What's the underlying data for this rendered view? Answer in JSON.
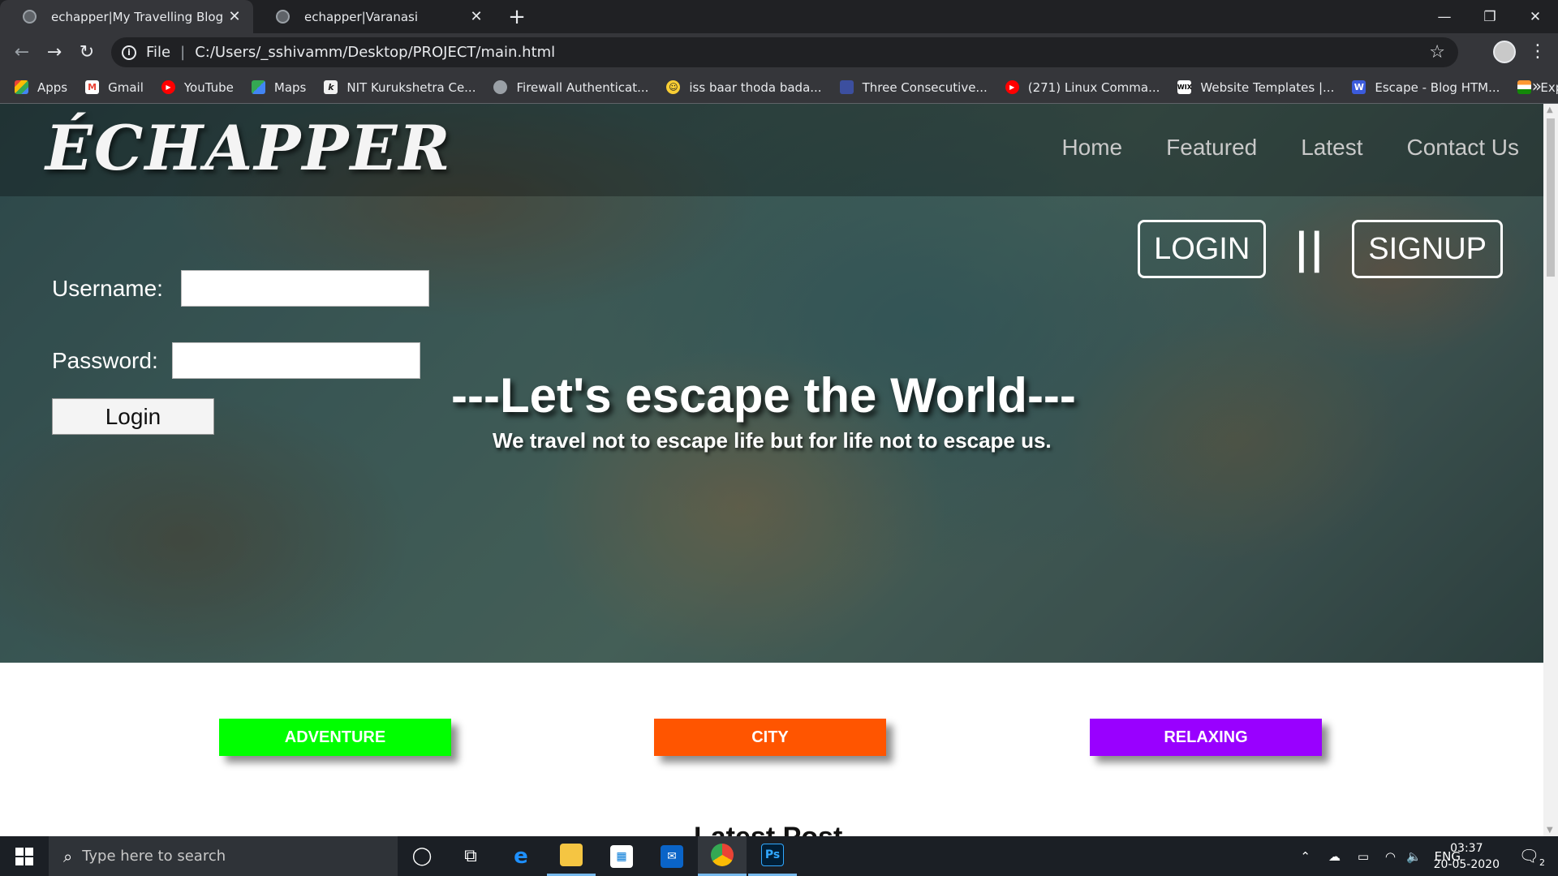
{
  "browser": {
    "tabs": [
      {
        "title": "echapper|My Travelling Blog",
        "active": true
      },
      {
        "title": "echapper|Varanasi",
        "active": false
      }
    ],
    "address": {
      "scheme": "File",
      "url": "C:/Users/_sshivamm/Desktop/PROJECT/main.html"
    },
    "bookmarks": [
      {
        "label": "Apps",
        "icon": "apps-grid-icon",
        "color": "#ea4335"
      },
      {
        "label": "Gmail",
        "icon": "gmail-icon",
        "color": "#ea4335"
      },
      {
        "label": "YouTube",
        "icon": "youtube-icon",
        "color": "#ff0000"
      },
      {
        "label": "Maps",
        "icon": "maps-icon",
        "color": "#34a853"
      },
      {
        "label": "NIT Kurukshetra Ce...",
        "icon": "nit-icon",
        "color": "#f1f1f1"
      },
      {
        "label": "Firewall Authenticat...",
        "icon": "globe-icon",
        "color": "#9aa0a6"
      },
      {
        "label": "iss baar thoda bada...",
        "icon": "emoji-icon",
        "color": "#f9ce34"
      },
      {
        "label": "Three Consecutive...",
        "icon": "doc-icon",
        "color": "#3c4f9f"
      },
      {
        "label": "(271) Linux Comma...",
        "icon": "youtube-icon",
        "color": "#ff0000"
      },
      {
        "label": "Website Templates |...",
        "icon": "wix-icon",
        "color": "#ffffff"
      },
      {
        "label": "Escape - Blog HTM...",
        "icon": "w-icon",
        "color": "#3b5bdb"
      },
      {
        "label": "Explore India",
        "icon": "india-flag-icon",
        "color": "#ff9933"
      }
    ]
  },
  "page": {
    "logo": "ÉCHAPPER",
    "nav": [
      "Home",
      "Featured",
      "Latest",
      "Contact Us"
    ],
    "auth": {
      "login": "LOGIN",
      "separator": "||",
      "signup": "SIGNUP"
    },
    "form": {
      "username_label": "Username:",
      "password_label": "Password:",
      "login_button": "Login"
    },
    "headline": "---Let's escape the World---",
    "subline": "We travel not to escape life but for life not to escape us.",
    "categories": [
      {
        "label": "ADVENTURE",
        "color": "#00ff00"
      },
      {
        "label": "CITY",
        "color": "#ff5500"
      },
      {
        "label": "RELAXING",
        "color": "#9900ff"
      }
    ],
    "section_title": "Latest Post"
  },
  "taskbar": {
    "search_placeholder": "Type here to search",
    "language": "ENG",
    "time": "03:37",
    "date": "20-05-2020",
    "notifications": "2"
  }
}
